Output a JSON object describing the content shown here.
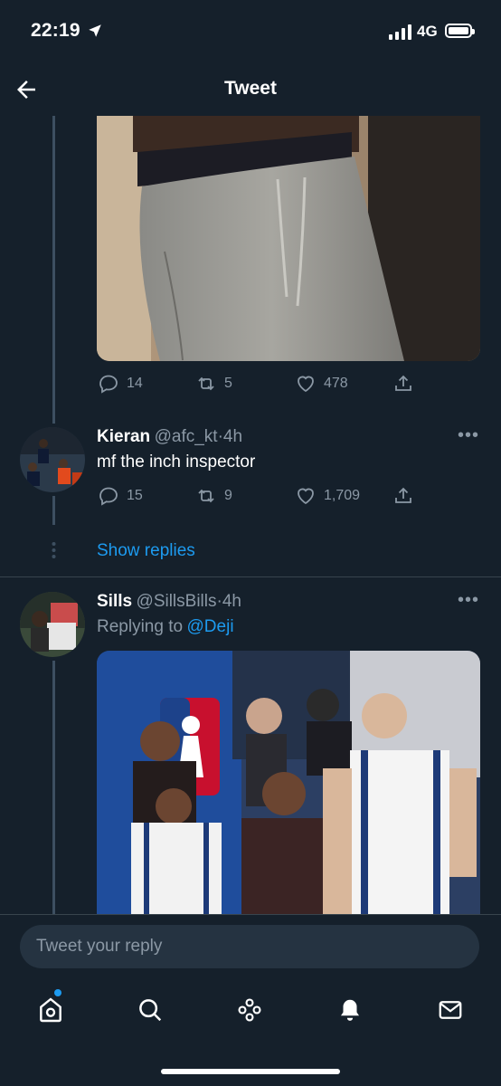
{
  "status": {
    "time": "22:19",
    "network": "4G"
  },
  "header": {
    "title": "Tweet"
  },
  "tweet_top": {
    "actions": {
      "replies": "14",
      "retweets": "5",
      "likes": "478"
    }
  },
  "reply1": {
    "name": "Kieran",
    "handle": "@afc_kt",
    "sep": "·",
    "time": "4h",
    "text": "mf the inch inspector",
    "actions": {
      "replies": "15",
      "retweets": "9",
      "likes": "1,709"
    }
  },
  "show_replies": "Show replies",
  "reply2": {
    "name": "Sills",
    "handle": "@SillsBills",
    "sep": "·",
    "time": "4h",
    "replying_prefix": "Replying to",
    "replying_to": "@Deji"
  },
  "reply_bar": {
    "placeholder": "Tweet your reply"
  },
  "tabs": [
    "home-icon",
    "search-icon",
    "spaces-icon",
    "notifications-icon",
    "messages-icon"
  ],
  "colors": {
    "background": "#15202b",
    "accent": "#1d9bf0",
    "muted": "#8b98a5"
  }
}
